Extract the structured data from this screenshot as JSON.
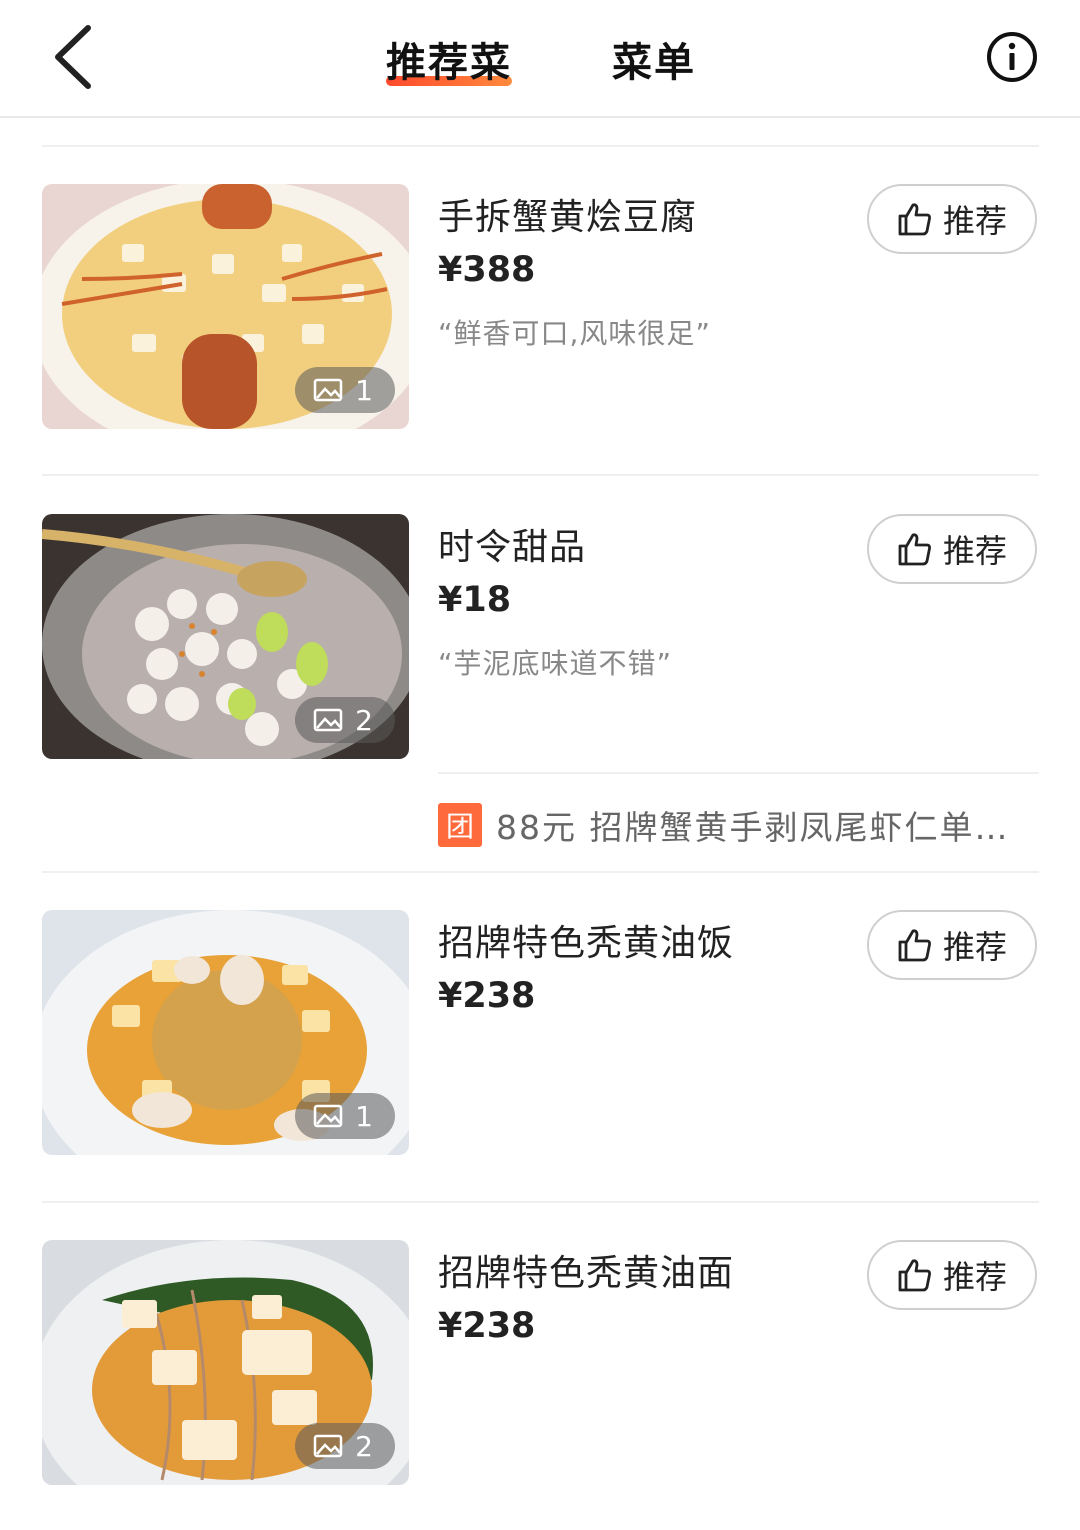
{
  "header": {
    "tabs": [
      {
        "label": "推荐菜",
        "active": true
      },
      {
        "label": "菜单",
        "active": false
      }
    ],
    "back_icon": "chevron-left-icon",
    "info_icon": "info-circle-icon"
  },
  "dishes": [
    {
      "name": "手拆蟹黄烩豆腐",
      "price": "¥388",
      "review": "“鲜香可口,风味很足”",
      "photo_count": "1",
      "recommend_label": "推荐"
    },
    {
      "name": "时令甜品",
      "price": "¥18",
      "review": "“芋泥底味道不错”",
      "photo_count": "2",
      "recommend_label": "推荐"
    },
    {
      "name": "招牌特色秃黄油饭",
      "price": "¥238",
      "review": "",
      "photo_count": "1",
      "recommend_label": "推荐"
    },
    {
      "name": "招牌特色秃黄油面",
      "price": "¥238",
      "review": "",
      "photo_count": "2",
      "recommend_label": "推荐"
    }
  ],
  "deal": {
    "badge": "团",
    "text": "88元 招牌蟹黄手剥凤尾虾仁单…"
  },
  "colors": {
    "accent": "#ff5a36",
    "deal_badge": "#ff6a3d"
  }
}
